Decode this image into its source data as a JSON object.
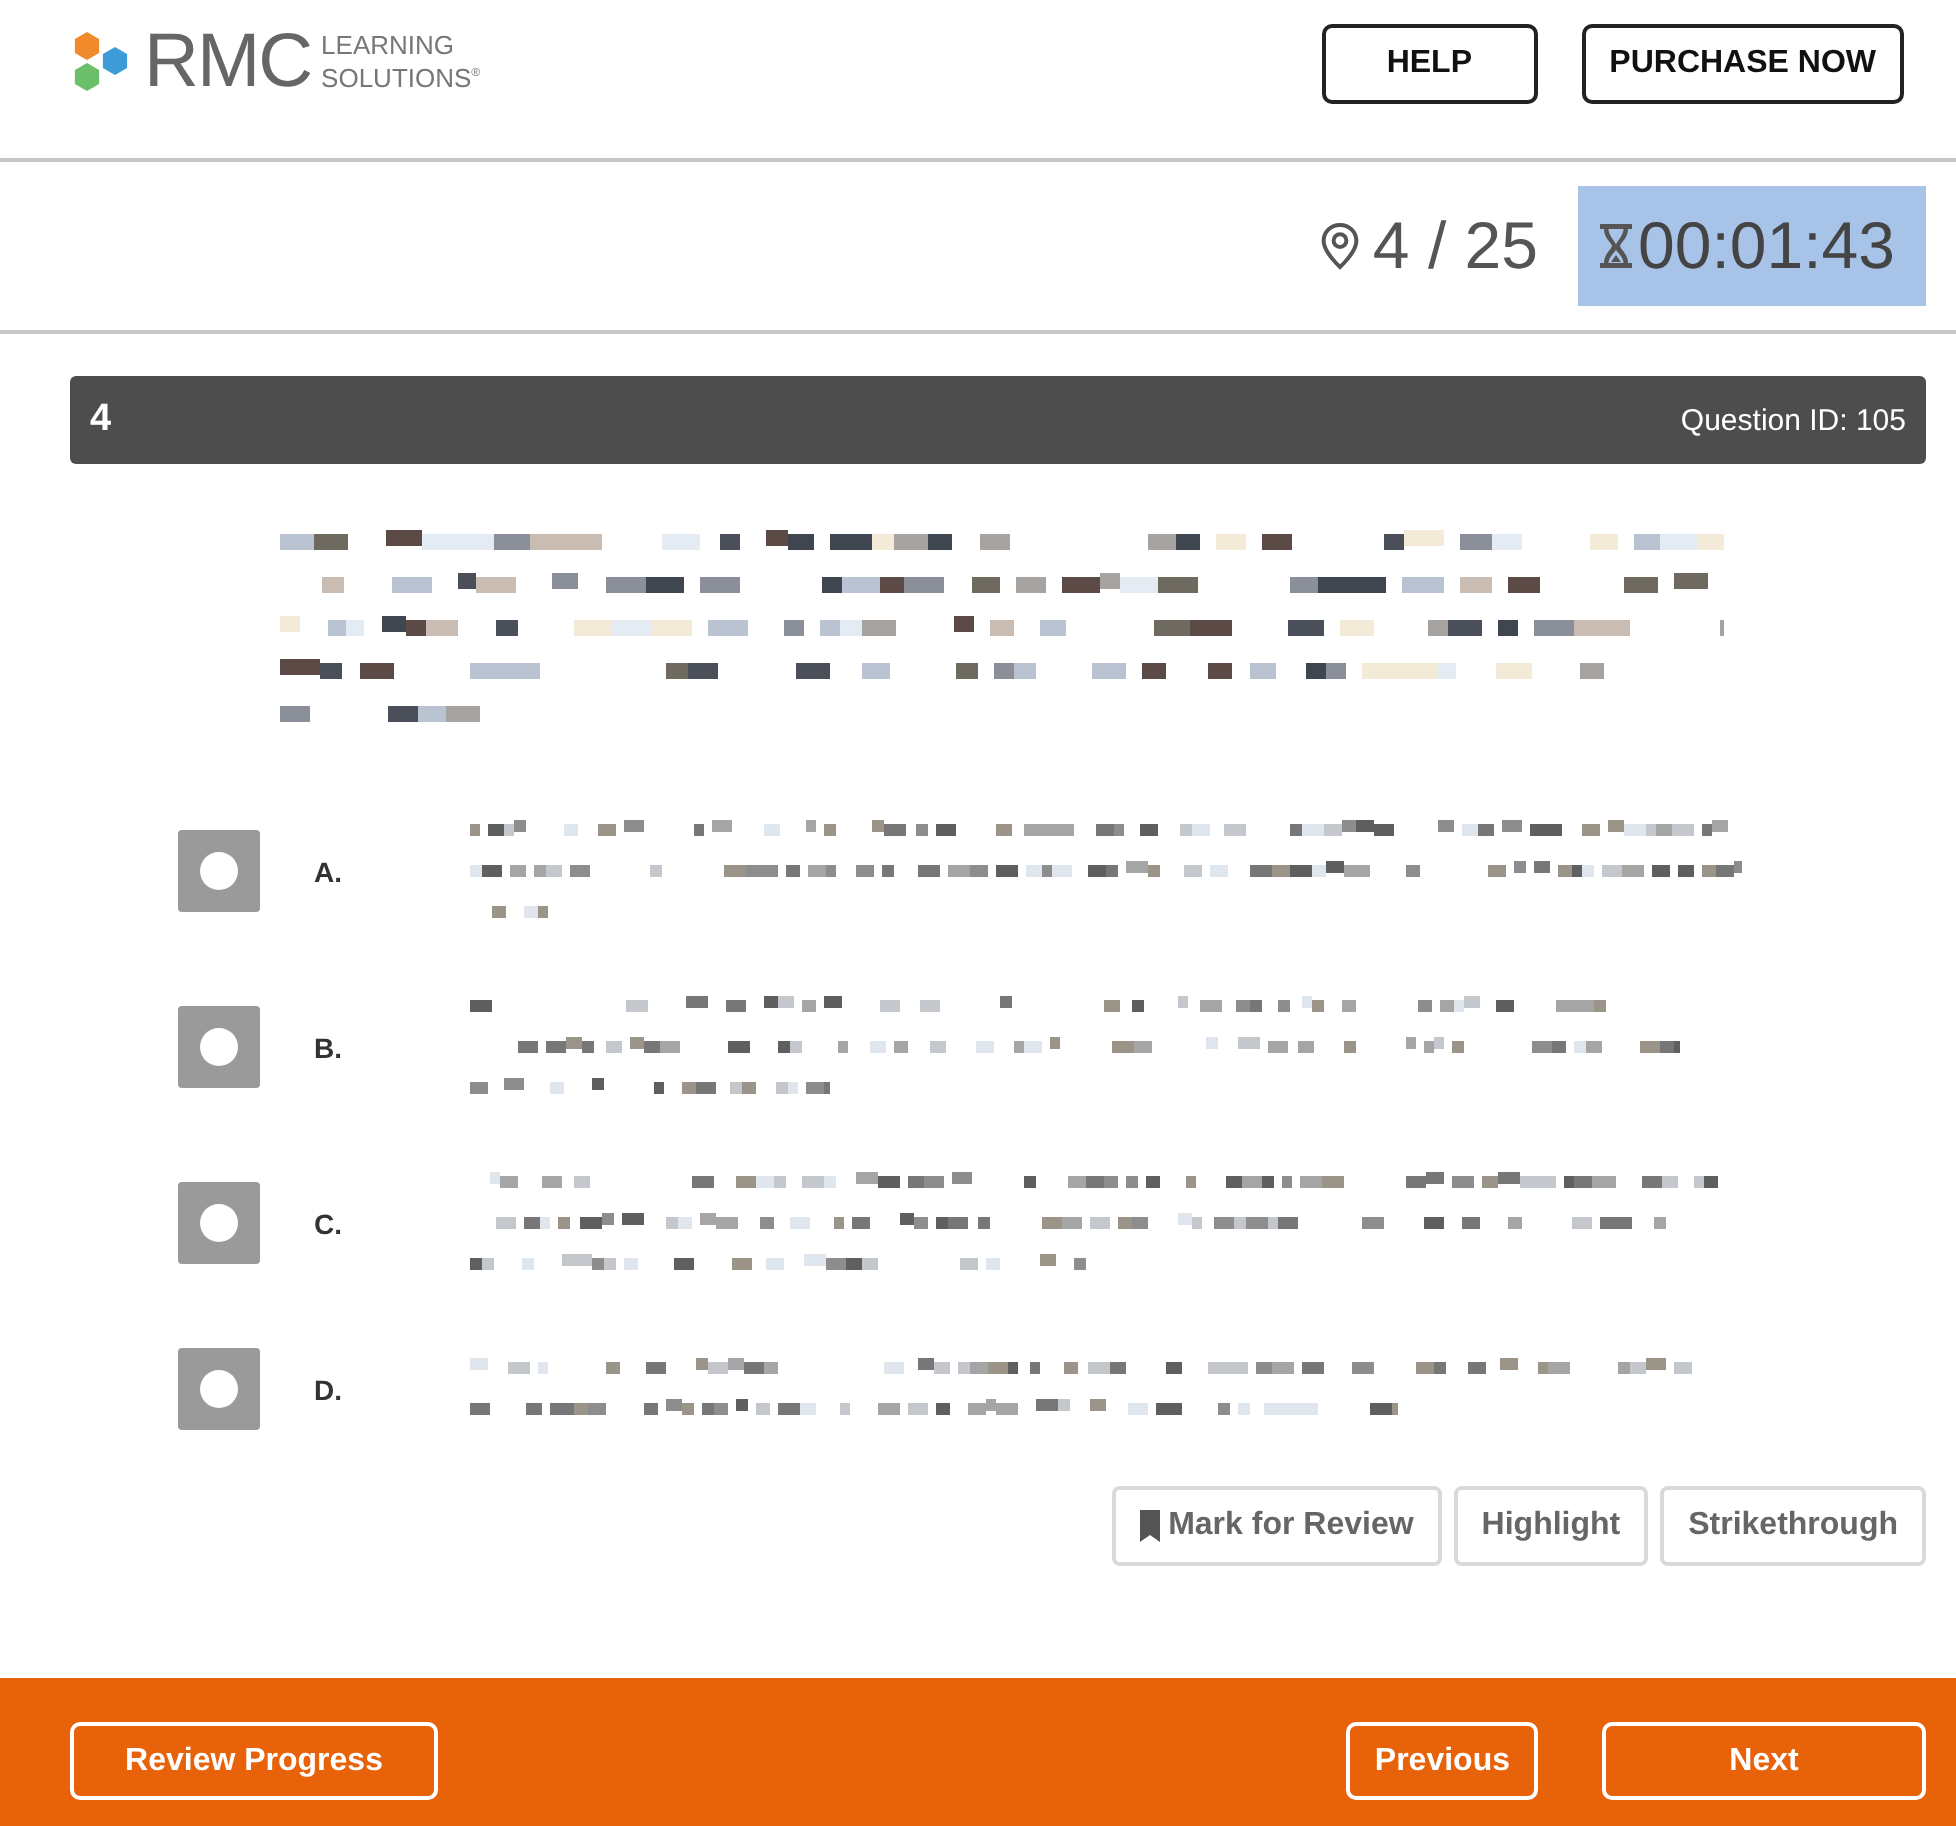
{
  "header": {
    "logo": {
      "name": "RMC",
      "line_1": "LEARNING",
      "line_2": "SOLUTIONS$^{®}$"
    },
    "buttons": [
      {
        "label": "HELP"
      },
      {
        "label": "PURCHASE NOW"
      }
    ]
  },
  "progress": {
    "position": "4 / 25",
    "timer": "00:01:43"
  },
  "question": {
    "number": "4",
    "id_label": "Question ID: 105",
    "options": [
      {
        "letter": "A.",
        "selected": false
      },
      {
        "letter": "B.",
        "selected": false
      },
      {
        "letter": "C.",
        "selected": false
      },
      {
        "letter": "D.",
        "selected": false
      }
    ]
  },
  "tools": [
    {
      "kind": "flag",
      "label": "Mark for Review"
    },
    {
      "kind": "plain",
      "label": "Highlight"
    },
    {
      "kind": "plain",
      "label": "Strikethrough"
    }
  ],
  "footer": {
    "left": [
      {
        "label": "Review Progress"
      }
    ],
    "right": [
      {
        "label": "Previous"
      },
      {
        "label": "Next"
      }
    ]
  }
}
